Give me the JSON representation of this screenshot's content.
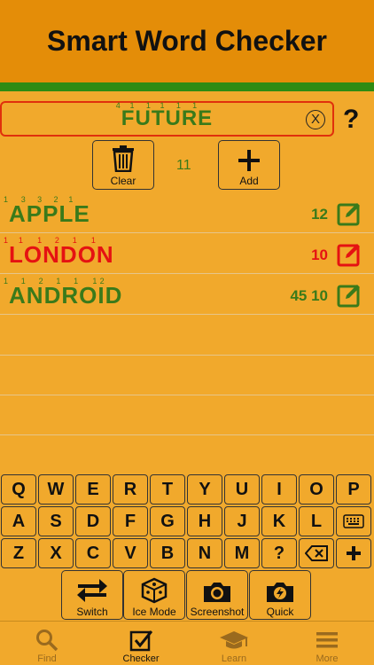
{
  "header": {
    "title": "Smart Word Checker"
  },
  "word_field": {
    "letters": [
      {
        "ch": "F",
        "pts": "4"
      },
      {
        "ch": "U",
        "pts": "1"
      },
      {
        "ch": "T",
        "pts": "1"
      },
      {
        "ch": "U",
        "pts": "1"
      },
      {
        "ch": "R",
        "pts": "1"
      },
      {
        "ch": "E",
        "pts": "1"
      }
    ],
    "word_sup": [
      "4",
      "1",
      "1",
      "1",
      "1",
      "1"
    ],
    "clear_symbol": "X"
  },
  "help_label": "?",
  "actions": {
    "clear_label": "Clear",
    "add_label": "Add",
    "count": "11"
  },
  "words": [
    {
      "letters": [
        "A",
        "P",
        "P",
        "L",
        "E"
      ],
      "pts": [
        "1",
        "3",
        "3",
        "2",
        "1"
      ],
      "score": "12",
      "color": "green"
    },
    {
      "letters": [
        "L",
        "O",
        "N",
        "D",
        "O",
        "N"
      ],
      "pts": [
        "1",
        "1",
        "1",
        "2",
        "1",
        "1"
      ],
      "score": "10",
      "color": "red"
    },
    {
      "letters": [
        "A",
        "N",
        "D",
        "R",
        "O",
        "I",
        "D"
      ],
      "pts": [
        "1",
        "1",
        "2",
        "1",
        "1",
        "1",
        "2"
      ],
      "score": "45 10",
      "color": "green"
    }
  ],
  "keyboard": {
    "row1": [
      "Q",
      "W",
      "E",
      "R",
      "T",
      "Y",
      "U",
      "I",
      "O",
      "P"
    ],
    "row2": [
      "A",
      "S",
      "D",
      "F",
      "G",
      "H",
      "J",
      "K",
      "L"
    ],
    "row3": [
      "Z",
      "X",
      "C",
      "V",
      "B",
      "N",
      "M",
      "?"
    ]
  },
  "tools": {
    "switch_label": "Switch",
    "ice_label": "Ice Mode",
    "screenshot_label": "Screenshot",
    "quick_label": "Quick"
  },
  "tabs": {
    "find": "Find",
    "checker": "Checker",
    "learn": "Learn",
    "more": "More"
  },
  "colors": {
    "background": "#f1a92c",
    "header": "#e48d08",
    "green": "#3a7a1a",
    "red": "#e51212"
  }
}
